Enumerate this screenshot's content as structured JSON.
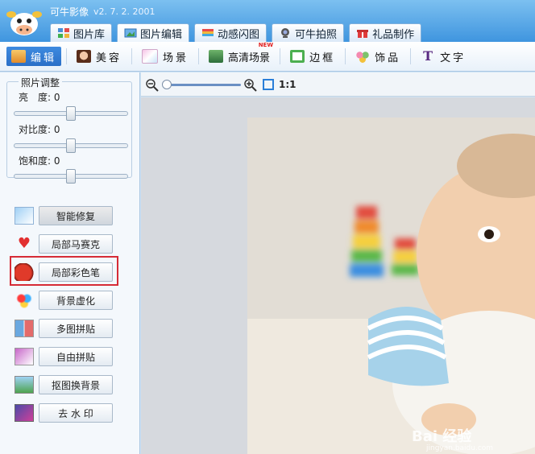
{
  "app": {
    "title": "可牛影像",
    "version": "v2. 7. 2. 2001"
  },
  "tabs": [
    {
      "label": "图片库",
      "icon": "gallery-icon"
    },
    {
      "label": "图片编辑",
      "icon": "edit-picture-icon"
    },
    {
      "label": "动感闪图",
      "icon": "flash-animation-icon"
    },
    {
      "label": "可牛拍照",
      "icon": "webcam-icon"
    },
    {
      "label": "礼品制作",
      "icon": "gift-icon"
    }
  ],
  "subtools": [
    {
      "label": "编辑",
      "icon": "edit-icon"
    },
    {
      "label": "美容",
      "icon": "beauty-face-icon"
    },
    {
      "label": "场景",
      "icon": "scene-icon"
    },
    {
      "label": "高清场景",
      "icon": "hd-scene-icon",
      "badge": "NEW"
    },
    {
      "label": "边框",
      "icon": "frame-icon"
    },
    {
      "label": "饰品",
      "icon": "accessory-icon"
    },
    {
      "label": "文字",
      "icon": "text-icon"
    }
  ],
  "adjust": {
    "title": "照片调整",
    "brightness": {
      "label": "亮　度:",
      "value": "0"
    },
    "contrast": {
      "label": "对比度:",
      "value": "0"
    },
    "saturation": {
      "label": "饱和度:",
      "value": "0"
    }
  },
  "tools": [
    {
      "label": "智能修复",
      "icon": "magic-wand-icon"
    },
    {
      "label": "局部马赛克",
      "icon": "mosaic-heart-icon"
    },
    {
      "label": "局部彩色笔",
      "icon": "apple-color-pen-icon"
    },
    {
      "label": "背景虚化",
      "icon": "blur-background-icon"
    },
    {
      "label": "多图拼贴",
      "icon": "multi-collage-icon"
    },
    {
      "label": "自由拼贴",
      "icon": "free-collage-icon"
    },
    {
      "label": "抠图换背景",
      "icon": "cutout-background-icon"
    },
    {
      "label": "去 水 印",
      "icon": "remove-watermark-icon"
    }
  ],
  "viewbar": {
    "zoom_ratio_label": "1:1"
  },
  "watermark": {
    "text": "Bai 经验",
    "sub": "jingyan.baidu.com"
  },
  "colors": {
    "accent": "#2a6fc7",
    "highlight": "#d62b36",
    "titlebar": "#3f95df"
  }
}
